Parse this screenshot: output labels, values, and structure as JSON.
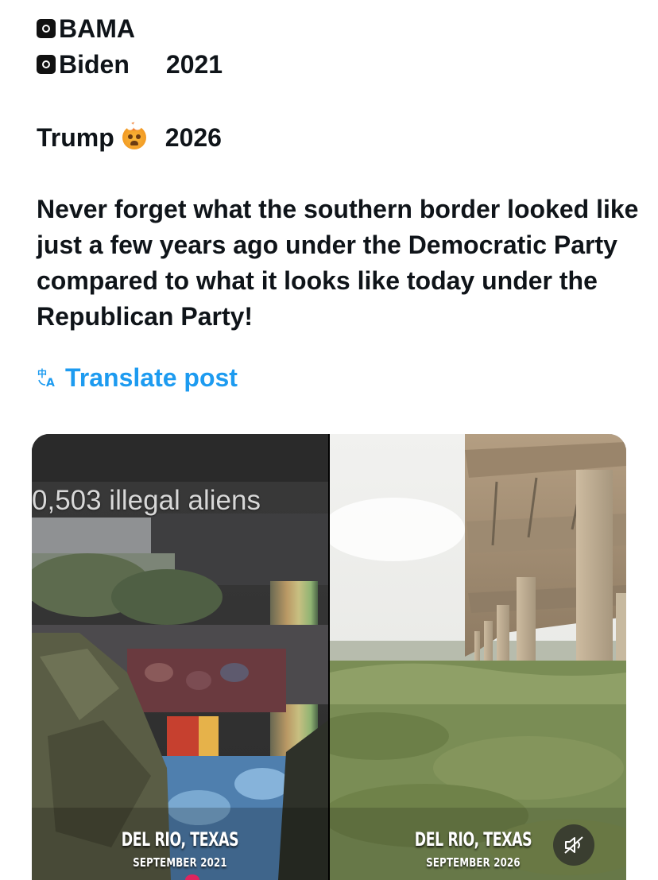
{
  "post": {
    "line1": "BAMA",
    "line2": "Biden",
    "line2_year": "2021",
    "line3": "Trump",
    "line3_year": "2026",
    "emoji_icon": "exploding-head-emoji",
    "body": "Never forget what the southern border looked like just a few years ago under the Democratic Party compared to what it looks like today under the Republican Party!",
    "translate_label": "Translate post",
    "translate_icon": "translate-icon",
    "accent_color": "#1d9bf0"
  },
  "video": {
    "left": {
      "overlay_text": "0,503 illegal aliens",
      "place": "DEL RIO, TEXAS",
      "date": "SEPTEMBER 2021"
    },
    "right": {
      "place": "DEL RIO, TEXAS",
      "date": "SEPTEMBER 2026"
    },
    "mute_icon": "volume-muted-icon"
  }
}
